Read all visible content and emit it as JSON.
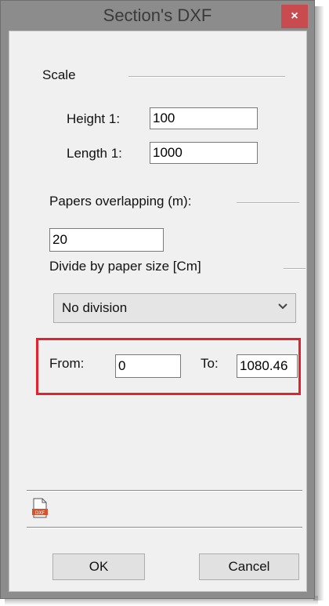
{
  "window": {
    "title": "Section's DXF",
    "close_glyph": "×"
  },
  "scale": {
    "heading": "Scale",
    "height_label": "Height 1:",
    "height_value": "100",
    "length_label": "Length 1:",
    "length_value": "1000"
  },
  "overlap": {
    "label": "Papers overlapping (m):",
    "value": "20"
  },
  "divide": {
    "label": "Divide by paper size [Cm]",
    "selected": "No division"
  },
  "range": {
    "from_label": "From:",
    "from_value": "0",
    "to_label": "To:",
    "to_value": "1080.46"
  },
  "toolbar": {
    "dxf_icon_text": "DXF"
  },
  "buttons": {
    "ok": "OK",
    "cancel": "Cancel"
  },
  "colors": {
    "highlight": "#e0232e",
    "titlebar": "#8c8c8c",
    "close": "#c74b4f"
  }
}
